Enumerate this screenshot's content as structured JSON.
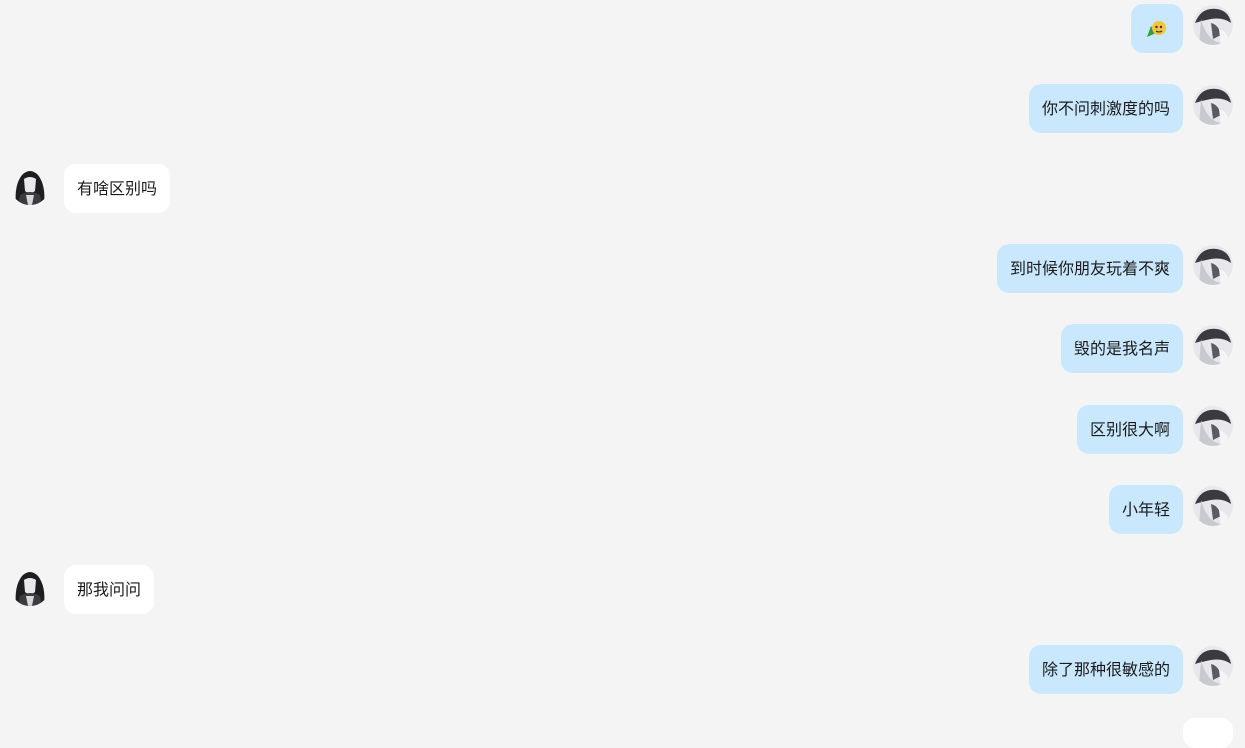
{
  "conversation": {
    "messages": [
      {
        "side": "out",
        "type": "emoji",
        "icon": "sticker-face-emoji"
      },
      {
        "side": "out",
        "type": "text",
        "text": "你不问刺激度的吗"
      },
      {
        "side": "in",
        "type": "text",
        "text": "有啥区别吗"
      },
      {
        "side": "out",
        "type": "text",
        "text": "到时候你朋友玩着不爽"
      },
      {
        "side": "out",
        "type": "text",
        "text": "毁的是我名声"
      },
      {
        "side": "out",
        "type": "text",
        "text": "区别很大啊"
      },
      {
        "side": "out",
        "type": "text",
        "text": "小年轻"
      },
      {
        "side": "in",
        "type": "text",
        "text": "那我问问"
      },
      {
        "side": "out",
        "type": "text",
        "text": "除了那种很敏感的"
      }
    ]
  },
  "colors": {
    "background": "#f4f4f4",
    "outgoing_bubble": "#c9e8fd",
    "incoming_bubble": "#ffffff",
    "text": "#1b1b1b"
  }
}
